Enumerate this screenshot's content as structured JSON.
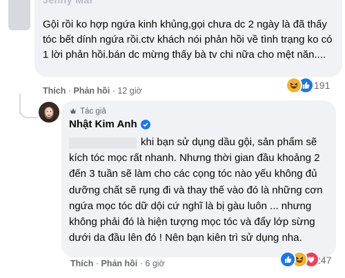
{
  "comment": {
    "author": "Jenny Mai",
    "text": "Gội rồi ko hợp ngứa kinh khủng,gọi chưa dc 2 ngày là đã thấy tóc bết dính ngứa rồi.ctv khách nói phản hồi về tình trạng ko có 1 lời phản hồi.bán dc mừng thấy bà tv chi nữa cho mệt năn....",
    "like_label": "Thích",
    "reply_label": "Phản hồi",
    "separator": "·",
    "time": "12 giờ",
    "reaction_count": "191",
    "reaction_icons": [
      "haha-icon",
      "like-icon"
    ]
  },
  "reply": {
    "role_label": "Tác giả",
    "author": "Nhật Kim Anh",
    "text": "khi bạn sử dụng dầu gội, sản phẩm sẽ kích tóc mọc rất nhanh. Nhưng thời gian đầu khoảng 2 đến 3 tuần sẽ làm cho các cọng tóc nào yếu không đủ dưỡng chất sẽ rụng đi và thay thế vào đó là những cơn ngứa mọc tóc dữ dội cứ nghĩ là bị gàu luôn ... nhưng không phải đó là hiện tượng mọc tóc và đẩy lớp sừng dưới da đầu lên đó ! Nên bạn kiên trì sử dụng nha.",
    "like_label": "Thích",
    "reply_label": "Phản hồi",
    "separator": "·",
    "time": "6 giờ",
    "reaction_count": "247",
    "reaction_icons": [
      "like-icon",
      "haha-icon",
      "love-icon"
    ]
  },
  "colors": {
    "bubble": "#f0f2f5",
    "secondary_text": "#65676b",
    "like_blue": "#1877f2",
    "haha_yellow": "#f7b125",
    "love_red": "#f33e58"
  }
}
